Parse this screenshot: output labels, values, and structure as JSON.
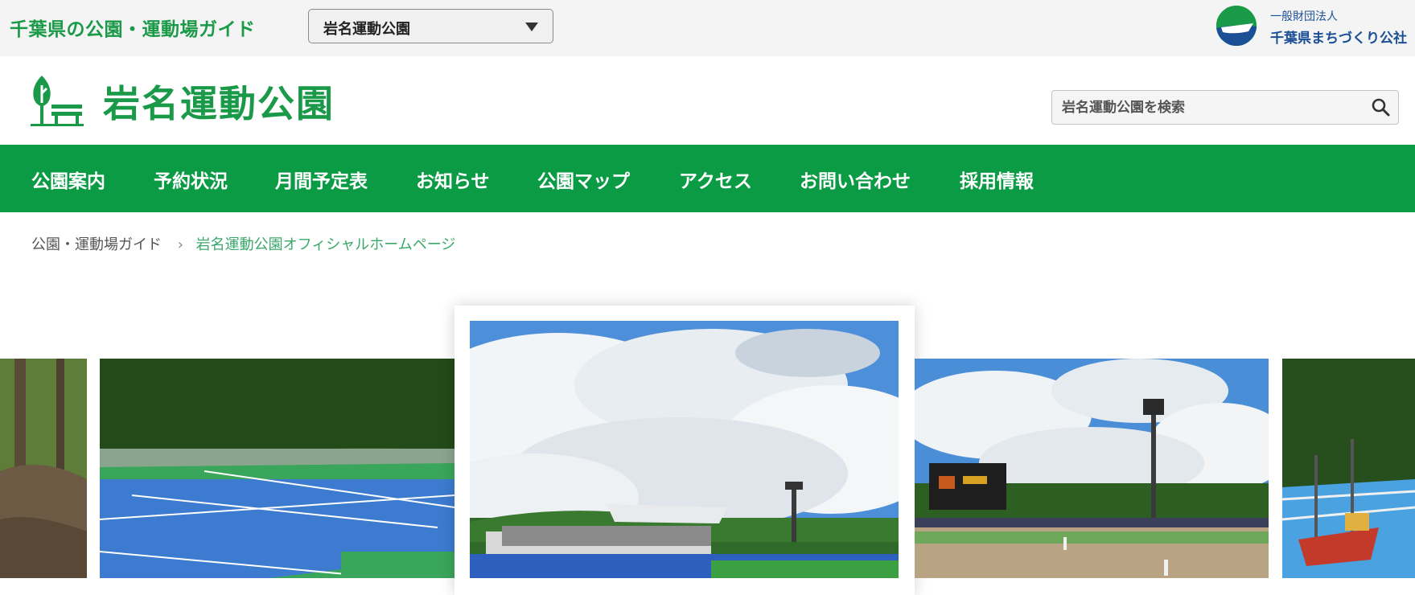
{
  "topbar": {
    "site_guide": "千葉県の公園・運動場ガイド",
    "park_select": {
      "selected": "岩名運動公園"
    },
    "corp": {
      "type": "一般財団法人",
      "name": "千葉県まちづくり公社"
    }
  },
  "header": {
    "title": "岩名運動公園",
    "search_placeholder": "岩名運動公園を検索"
  },
  "nav": {
    "items": [
      "公園案内",
      "予約状況",
      "月間予定表",
      "お知らせ",
      "公園マップ",
      "アクセス",
      "お問い合わせ",
      "採用情報"
    ]
  },
  "breadcrumb": {
    "home": "公園・運動場ガイド",
    "current": "岩名運動公園オフィシャルホームページ"
  },
  "colors": {
    "brand_green": "#1a9a48",
    "nav_green": "#0b9b45",
    "corp_blue": "#1b4f96"
  },
  "icons": {
    "dropdown": "chevron-down-icon",
    "search": "search-icon",
    "logo": "tree-bench-icon"
  }
}
